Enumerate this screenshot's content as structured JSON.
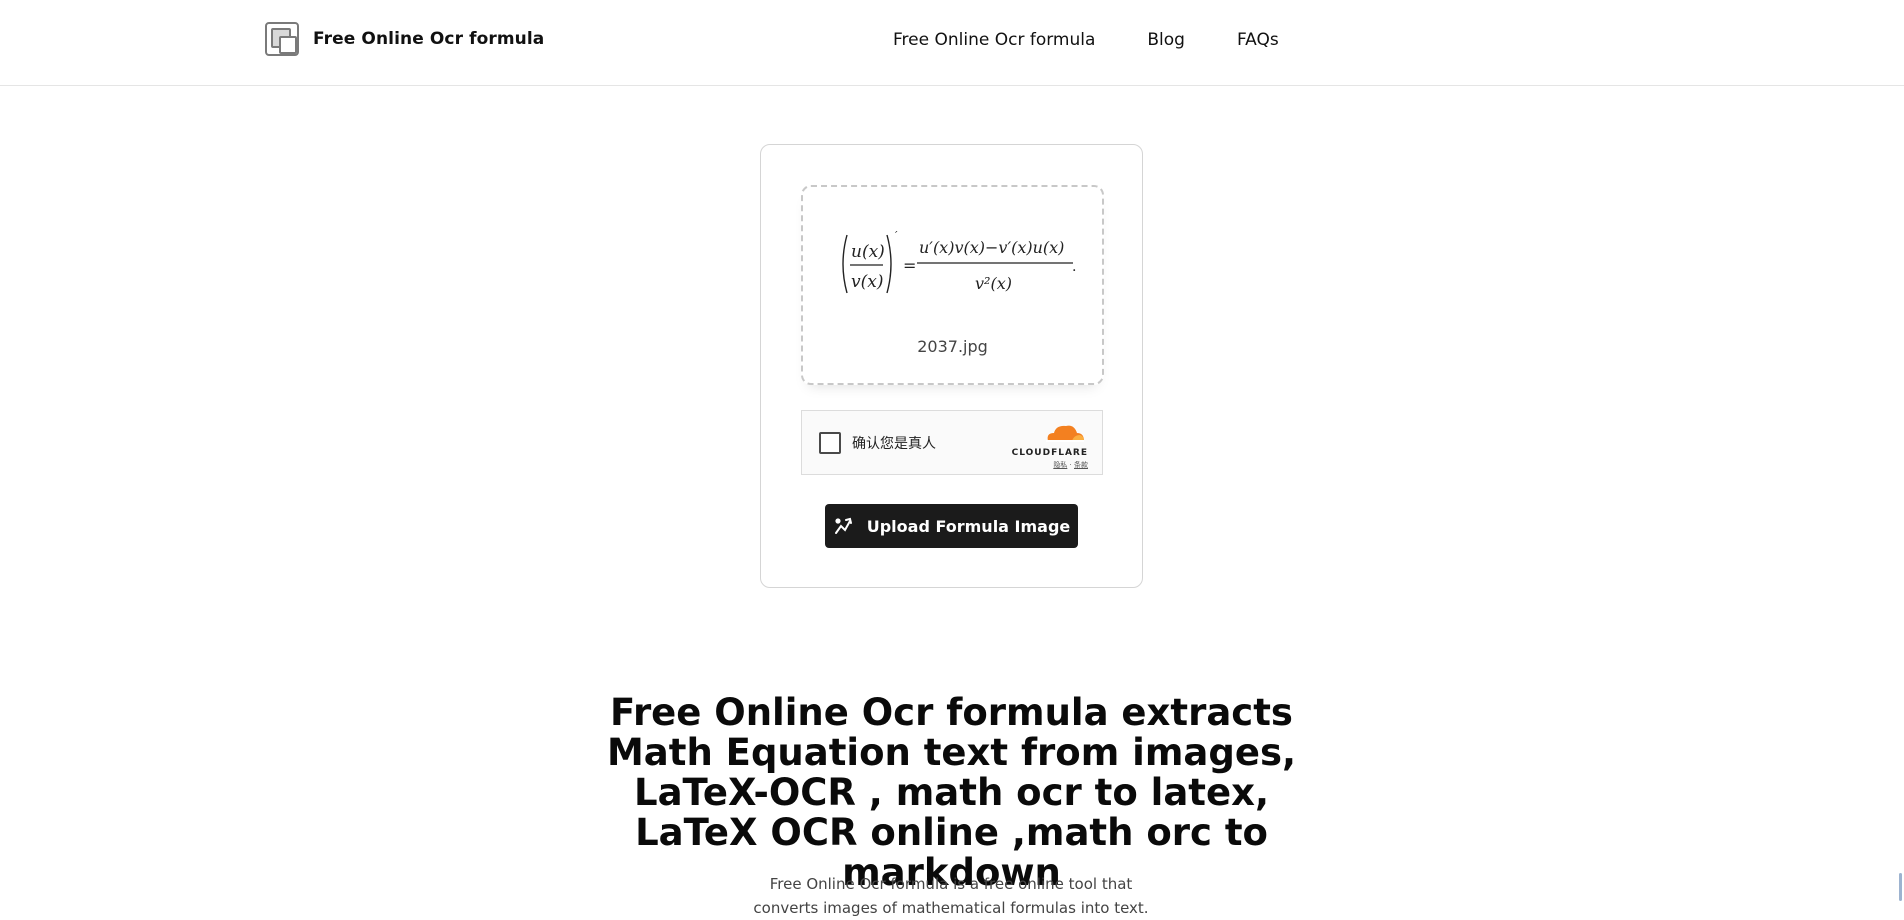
{
  "header": {
    "logo_text": "Free Online Ocr formula",
    "nav": [
      {
        "label": "Free Online Ocr formula"
      },
      {
        "label": "Blog"
      },
      {
        "label": "FAQs"
      }
    ]
  },
  "upload_card": {
    "file_name": "2037.jpg",
    "captcha": {
      "label": "确认您是真人",
      "brand": "CLOUDFLARE",
      "link1": "隐私",
      "link2": "条款"
    },
    "upload_button": "Upload Formula Image"
  },
  "hero": {
    "title": "Free Online Ocr formula extracts Math Equation text from images, LaTeX-OCR , math ocr to latex, LaTeX OCR online ,math orc to markdown",
    "description": "Free Online Ocr formula is a free online tool that converts images of mathematical formulas into text."
  },
  "colors": {
    "button_bg": "#1b1b1b",
    "cloudflare_orange": "#f38020"
  }
}
